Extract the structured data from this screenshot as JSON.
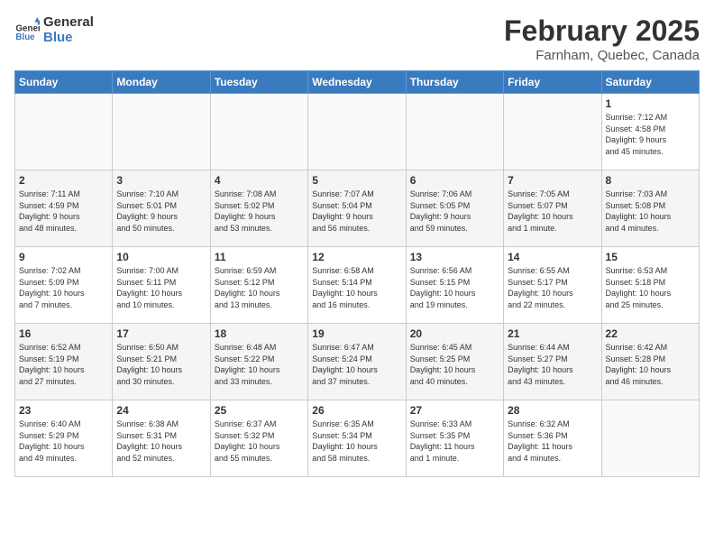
{
  "logo": {
    "line1": "General",
    "line2": "Blue"
  },
  "title": "February 2025",
  "location": "Farnham, Quebec, Canada",
  "weekdays": [
    "Sunday",
    "Monday",
    "Tuesday",
    "Wednesday",
    "Thursday",
    "Friday",
    "Saturday"
  ],
  "weeks": [
    [
      {
        "day": "",
        "info": ""
      },
      {
        "day": "",
        "info": ""
      },
      {
        "day": "",
        "info": ""
      },
      {
        "day": "",
        "info": ""
      },
      {
        "day": "",
        "info": ""
      },
      {
        "day": "",
        "info": ""
      },
      {
        "day": "1",
        "info": "Sunrise: 7:12 AM\nSunset: 4:58 PM\nDaylight: 9 hours\nand 45 minutes."
      }
    ],
    [
      {
        "day": "2",
        "info": "Sunrise: 7:11 AM\nSunset: 4:59 PM\nDaylight: 9 hours\nand 48 minutes."
      },
      {
        "day": "3",
        "info": "Sunrise: 7:10 AM\nSunset: 5:01 PM\nDaylight: 9 hours\nand 50 minutes."
      },
      {
        "day": "4",
        "info": "Sunrise: 7:08 AM\nSunset: 5:02 PM\nDaylight: 9 hours\nand 53 minutes."
      },
      {
        "day": "5",
        "info": "Sunrise: 7:07 AM\nSunset: 5:04 PM\nDaylight: 9 hours\nand 56 minutes."
      },
      {
        "day": "6",
        "info": "Sunrise: 7:06 AM\nSunset: 5:05 PM\nDaylight: 9 hours\nand 59 minutes."
      },
      {
        "day": "7",
        "info": "Sunrise: 7:05 AM\nSunset: 5:07 PM\nDaylight: 10 hours\nand 1 minute."
      },
      {
        "day": "8",
        "info": "Sunrise: 7:03 AM\nSunset: 5:08 PM\nDaylight: 10 hours\nand 4 minutes."
      }
    ],
    [
      {
        "day": "9",
        "info": "Sunrise: 7:02 AM\nSunset: 5:09 PM\nDaylight: 10 hours\nand 7 minutes."
      },
      {
        "day": "10",
        "info": "Sunrise: 7:00 AM\nSunset: 5:11 PM\nDaylight: 10 hours\nand 10 minutes."
      },
      {
        "day": "11",
        "info": "Sunrise: 6:59 AM\nSunset: 5:12 PM\nDaylight: 10 hours\nand 13 minutes."
      },
      {
        "day": "12",
        "info": "Sunrise: 6:58 AM\nSunset: 5:14 PM\nDaylight: 10 hours\nand 16 minutes."
      },
      {
        "day": "13",
        "info": "Sunrise: 6:56 AM\nSunset: 5:15 PM\nDaylight: 10 hours\nand 19 minutes."
      },
      {
        "day": "14",
        "info": "Sunrise: 6:55 AM\nSunset: 5:17 PM\nDaylight: 10 hours\nand 22 minutes."
      },
      {
        "day": "15",
        "info": "Sunrise: 6:53 AM\nSunset: 5:18 PM\nDaylight: 10 hours\nand 25 minutes."
      }
    ],
    [
      {
        "day": "16",
        "info": "Sunrise: 6:52 AM\nSunset: 5:19 PM\nDaylight: 10 hours\nand 27 minutes."
      },
      {
        "day": "17",
        "info": "Sunrise: 6:50 AM\nSunset: 5:21 PM\nDaylight: 10 hours\nand 30 minutes."
      },
      {
        "day": "18",
        "info": "Sunrise: 6:48 AM\nSunset: 5:22 PM\nDaylight: 10 hours\nand 33 minutes."
      },
      {
        "day": "19",
        "info": "Sunrise: 6:47 AM\nSunset: 5:24 PM\nDaylight: 10 hours\nand 37 minutes."
      },
      {
        "day": "20",
        "info": "Sunrise: 6:45 AM\nSunset: 5:25 PM\nDaylight: 10 hours\nand 40 minutes."
      },
      {
        "day": "21",
        "info": "Sunrise: 6:44 AM\nSunset: 5:27 PM\nDaylight: 10 hours\nand 43 minutes."
      },
      {
        "day": "22",
        "info": "Sunrise: 6:42 AM\nSunset: 5:28 PM\nDaylight: 10 hours\nand 46 minutes."
      }
    ],
    [
      {
        "day": "23",
        "info": "Sunrise: 6:40 AM\nSunset: 5:29 PM\nDaylight: 10 hours\nand 49 minutes."
      },
      {
        "day": "24",
        "info": "Sunrise: 6:38 AM\nSunset: 5:31 PM\nDaylight: 10 hours\nand 52 minutes."
      },
      {
        "day": "25",
        "info": "Sunrise: 6:37 AM\nSunset: 5:32 PM\nDaylight: 10 hours\nand 55 minutes."
      },
      {
        "day": "26",
        "info": "Sunrise: 6:35 AM\nSunset: 5:34 PM\nDaylight: 10 hours\nand 58 minutes."
      },
      {
        "day": "27",
        "info": "Sunrise: 6:33 AM\nSunset: 5:35 PM\nDaylight: 11 hours\nand 1 minute."
      },
      {
        "day": "28",
        "info": "Sunrise: 6:32 AM\nSunset: 5:36 PM\nDaylight: 11 hours\nand 4 minutes."
      },
      {
        "day": "",
        "info": ""
      }
    ]
  ]
}
